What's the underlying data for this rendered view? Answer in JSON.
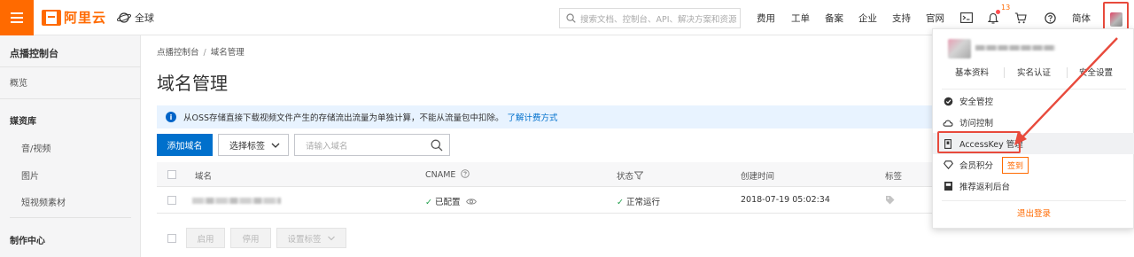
{
  "colors": {
    "brand": "#ff6a00",
    "primary": "#0064c8",
    "highlight": "#e84a3c",
    "success": "#1e9e4a"
  },
  "header": {
    "logo_text": "阿里云",
    "region": "全球",
    "search_placeholder": "搜索文档、控制台、API、解决方案和资源",
    "nav": [
      "费用",
      "工单",
      "备案",
      "企业",
      "支持",
      "官网"
    ],
    "cart_count": "13",
    "language": "简体",
    "icons": [
      "terminal-icon",
      "bell-icon",
      "cart-icon",
      "help-icon"
    ]
  },
  "sidebar": {
    "title": "点播控制台",
    "overview": "概览",
    "media_title": "媒资库",
    "media_items": [
      "音/视频",
      "图片",
      "短视频素材"
    ],
    "production_title": "制作中心"
  },
  "breadcrumb": {
    "root": "点播控制台",
    "separator": "/",
    "current": "域名管理"
  },
  "page_title": "域名管理",
  "notice": {
    "text": "从OSS存储直接下载视频文件产生的存储流出流量为单独计算，不能从流量包中扣除。",
    "link": "了解计费方式"
  },
  "toolbar": {
    "add_domain": "添加域名",
    "select_tag": "选择标签",
    "domain_placeholder": "请输入域名"
  },
  "table": {
    "columns": [
      "域名",
      "CNAME",
      "状态",
      "创建时间",
      "标签"
    ],
    "rows": [
      {
        "cname": "已配置",
        "status": "正常运行",
        "created": "2018-07-19 05:02:34"
      }
    ]
  },
  "footer_buttons": [
    "启用",
    "停用",
    "设置标签"
  ],
  "user_menu": {
    "links": [
      "基本资料",
      "实名认证",
      "安全设置"
    ],
    "items": [
      "安全管控",
      "访问控制",
      "AccessKey 管理",
      "会员积分",
      "推荐返利后台"
    ],
    "sign_in": "签到",
    "logout": "退出登录"
  }
}
